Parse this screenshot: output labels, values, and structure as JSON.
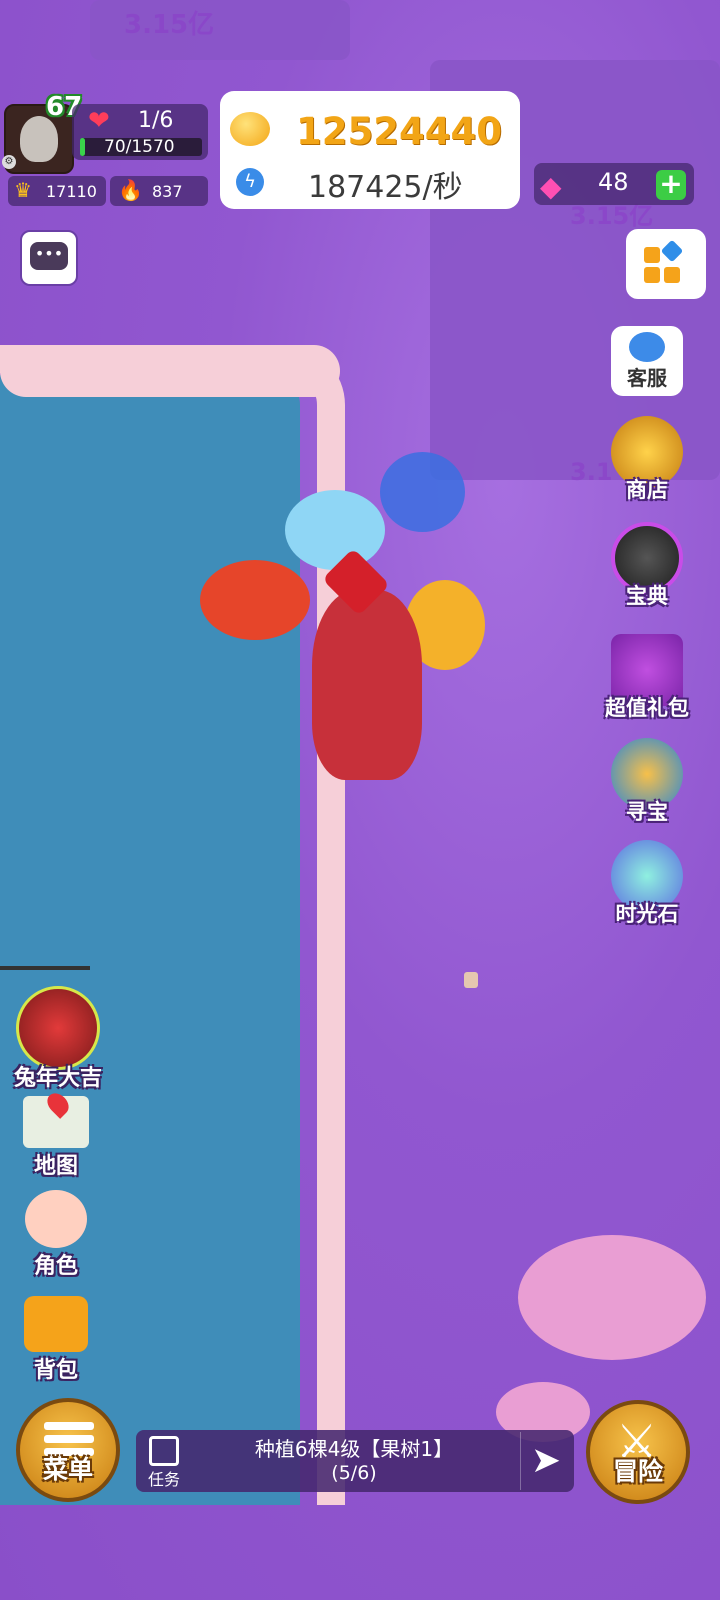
{
  "watermarks": [
    "3.15亿",
    "3.15亿",
    "3.1"
  ],
  "player": {
    "level": "67",
    "hearts": "1/6",
    "hp": "70/1570",
    "hp_fraction": 0.045,
    "crown_value": "17110",
    "fire_value": "837"
  },
  "currency": {
    "gold": "12524440",
    "rate": "187425/秒",
    "gems": "48"
  },
  "right_menu": {
    "kefu": "客服",
    "shop": "商店",
    "baodian": "宝典",
    "gift": "超值礼包",
    "treasure": "寻宝",
    "timestone": "时光石"
  },
  "left_menu": {
    "rabbit_event": "兔年大吉",
    "map": "地图",
    "character": "角色",
    "bag": "背包"
  },
  "bottom": {
    "menu_label": "菜单",
    "task_label": "任务",
    "task_title": "种植6棵4级【果树1】",
    "task_progress": "(5/6)",
    "adventure_label": "冒险"
  },
  "colors": {
    "gold": "#f2a516",
    "background": "#9a63d6",
    "lake": "#3f8db9",
    "cloud": "#f6cfd8",
    "hp_fill": "#3ad24b",
    "gem": "#ff4fb3"
  },
  "icons": [
    "coin-icon",
    "lightning-icon",
    "gem-icon",
    "plus-icon",
    "heart-icon",
    "crown-icon",
    "fire-icon",
    "chat-icon",
    "grid-menu-icon",
    "headset-icon",
    "shop-chest-icon",
    "helmet-icon",
    "gift-box-icon",
    "treasure-chest-icon",
    "hourglass-gem-icon",
    "rabbit-icon",
    "map-icon",
    "face-icon",
    "backpack-icon",
    "list-icon",
    "clipboard-icon",
    "arrow-right-icon",
    "crossed-swords-icon"
  ]
}
